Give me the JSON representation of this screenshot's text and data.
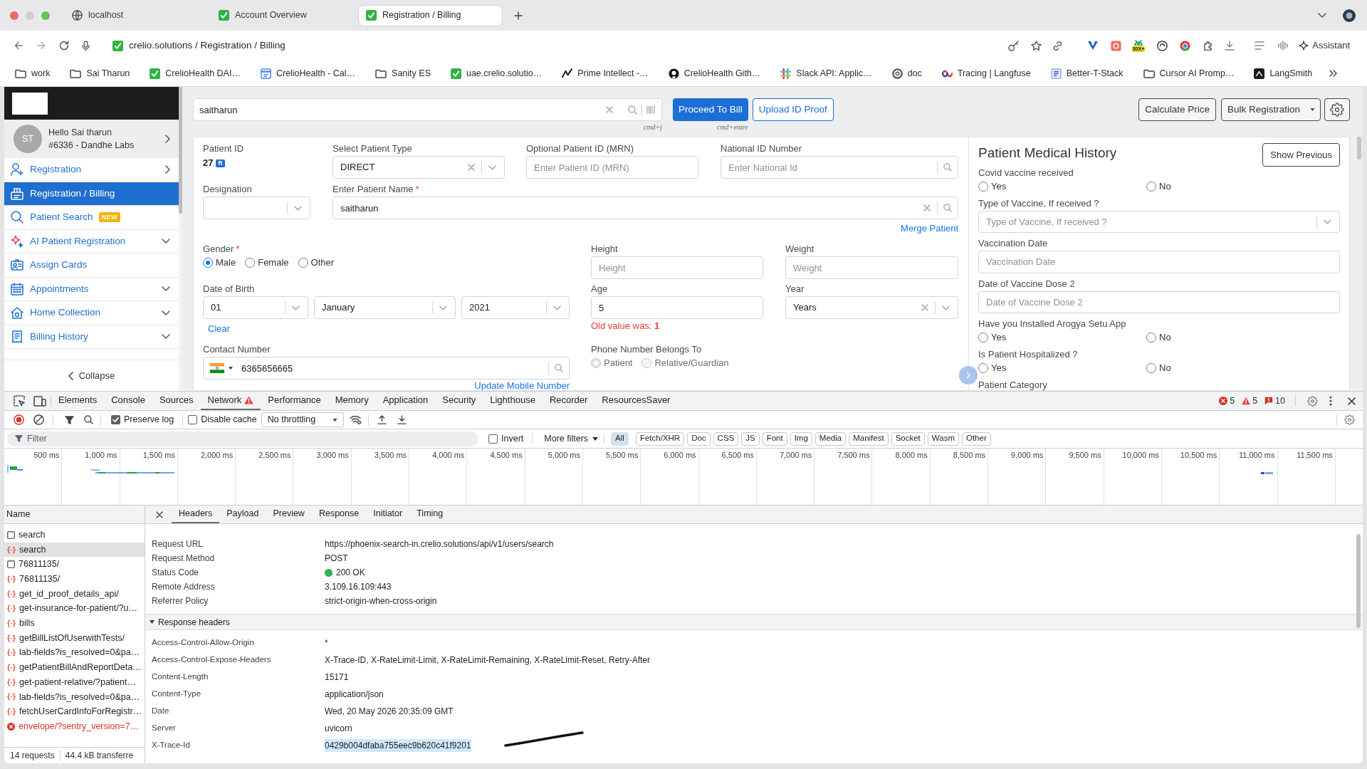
{
  "browser": {
    "tabs": [
      {
        "title": "localhost",
        "selected": false
      },
      {
        "title": "Account Overview",
        "selected": false
      },
      {
        "title": "Registration / Billing",
        "selected": true
      }
    ],
    "address": "crelio.solutions / Registration / Billing",
    "extension_badge": "30X+",
    "assistant": "Assistant",
    "bookmarks": [
      {
        "label": "work",
        "kind": "folder"
      },
      {
        "label": "Sai Tharun",
        "kind": "folder"
      },
      {
        "label": "CrelioHealth DAI…",
        "kind": "site"
      },
      {
        "label": "CrelioHealth - Cal…",
        "kind": "site"
      },
      {
        "label": "Sanity ES",
        "kind": "folder"
      },
      {
        "label": "uae.crelio.solutio…",
        "kind": "site"
      },
      {
        "label": "Prime Intellect -…",
        "kind": "site"
      },
      {
        "label": "CrelioHealth Gith…",
        "kind": "site"
      },
      {
        "label": "Slack API: Applic…",
        "kind": "site"
      },
      {
        "label": "doc",
        "kind": "site"
      },
      {
        "label": "Tracing | Langfuse",
        "kind": "site"
      },
      {
        "label": "Better-T-Stack",
        "kind": "site"
      },
      {
        "label": "Cursor AI Promp…",
        "kind": "folder"
      },
      {
        "label": "LangSmith",
        "kind": "site"
      }
    ]
  },
  "sidebar": {
    "avatar": "ST",
    "greeting": "Hello Sai tharun",
    "account": "#6336 - Dandhe Labs",
    "items": [
      {
        "label": "Registration",
        "kind": "flyout",
        "selected": false
      },
      {
        "label": "Registration / Billing",
        "kind": "page",
        "selected": true
      },
      {
        "label": "Patient Search",
        "kind": "page",
        "selected": false,
        "badge": "NEW"
      },
      {
        "label": "AI Patient Registration",
        "kind": "group",
        "selected": false
      },
      {
        "label": "Assign Cards",
        "kind": "page",
        "selected": false
      },
      {
        "label": "Appointments",
        "kind": "group",
        "selected": false
      },
      {
        "label": "Home Collection",
        "kind": "group",
        "selected": false
      },
      {
        "label": "Billing History",
        "kind": "group",
        "selected": false
      }
    ],
    "collapse": "Collapse"
  },
  "search": {
    "value": "saitharun",
    "shortcut": "cmd+j"
  },
  "actions": [
    {
      "label": "Proceed To Bill",
      "kind": "primary",
      "shortcut": "cmd+enter"
    },
    {
      "label": "Upload ID Proof",
      "kind": "outline"
    }
  ],
  "tools": [
    {
      "label": "Calculate Price",
      "kind": "button"
    },
    {
      "label": "Bulk Registration",
      "kind": "dropdown"
    }
  ],
  "form": {
    "patient_id": {
      "label": "Patient ID",
      "value": "27",
      "badge": "R"
    },
    "patient_type": {
      "label": "Select Patient Type",
      "value": "DIRECT"
    },
    "mrn": {
      "label": "Optional Patient ID (MRN)",
      "placeholder": "Enter Patient ID (MRN)"
    },
    "national_id": {
      "label": "National ID Number",
      "placeholder": "Enter National Id"
    },
    "designation": {
      "label": "Designation"
    },
    "patient_name": {
      "label": "Enter Patient Name",
      "required_mark": "*",
      "value": "saitharun"
    },
    "merge_link": "Merge Patient",
    "gender": {
      "label": "Gender",
      "required_mark": "*",
      "options": [
        {
          "label": "Male",
          "selected": true
        },
        {
          "label": "Female",
          "selected": false
        },
        {
          "label": "Other",
          "selected": false
        }
      ]
    },
    "height": {
      "label": "Height",
      "placeholder": "Height"
    },
    "weight": {
      "label": "Weight",
      "placeholder": "Weight"
    },
    "dob": {
      "label": "Date of Birth",
      "parts": [
        "01",
        "January",
        "2021"
      ],
      "clear_link": "Clear"
    },
    "age": {
      "label": "Age",
      "value": "5",
      "note": "Old value was: **1**"
    },
    "age_unit": {
      "label": "Year",
      "value": "Years"
    },
    "contact": {
      "label": "Contact Number",
      "value": "6365656665",
      "update_link": "Update Mobile Number"
    },
    "phone_owner": {
      "label": "Phone Number Belongs To",
      "disabled": true,
      "options": [
        {
          "label": "Patient",
          "selected": true
        },
        {
          "label": "Relative/Guardian",
          "selected": false
        }
      ]
    }
  },
  "history": {
    "title": "Patient Medical History",
    "show_previous": "Show Previous",
    "fields": [
      {
        "kind": "radio",
        "label": "Covid vaccine received",
        "options": [
          {
            "label": "Yes",
            "selected": false
          },
          {
            "label": "No",
            "selected": false
          }
        ]
      },
      {
        "kind": "select",
        "label": "Type of Vaccine, If received ?",
        "placeholder": "Type of Vaccine, If received ?"
      },
      {
        "kind": "input",
        "label": "Vaccination Date",
        "placeholder": "Vaccination Date"
      },
      {
        "kind": "input",
        "label": "Date of Vaccine Dose 2",
        "placeholder": "Date of Vaccine Dose 2"
      },
      {
        "kind": "radio",
        "label": "Have you Installed Arogya Setu App",
        "options": [
          {
            "label": "Yes",
            "selected": false
          },
          {
            "label": "No",
            "selected": false
          }
        ]
      },
      {
        "kind": "radio",
        "label": "Is Patient Hospitalized ?",
        "options": [
          {
            "label": "Yes",
            "selected": false
          },
          {
            "label": "No",
            "selected": false
          }
        ]
      },
      {
        "kind": "label",
        "label": "Patient Category"
      }
    ]
  },
  "devtools": {
    "tabs": [
      {
        "label": "Elements",
        "selected": false,
        "warning": false
      },
      {
        "label": "Console",
        "selected": false,
        "warning": false
      },
      {
        "label": "Sources",
        "selected": false,
        "warning": false
      },
      {
        "label": "Network",
        "selected": true,
        "warning": true
      },
      {
        "label": "Performance",
        "selected": false,
        "warning": false
      },
      {
        "label": "Memory",
        "selected": false,
        "warning": false
      },
      {
        "label": "Application",
        "selected": false,
        "warning": false
      },
      {
        "label": "Security",
        "selected": false,
        "warning": false
      },
      {
        "label": "Lighthouse",
        "selected": false,
        "warning": false
      },
      {
        "label": "Recorder",
        "selected": false,
        "warning": false
      },
      {
        "label": "ResourcesSaver",
        "selected": false,
        "warning": false
      }
    ],
    "counts": [
      {
        "kind": "error",
        "value": "5"
      },
      {
        "kind": "warning",
        "value": "5"
      },
      {
        "kind": "message",
        "value": "10"
      }
    ],
    "preserve_log": {
      "label": "Preserve log",
      "checked": true
    },
    "disable_cache": {
      "label": "Disable cache",
      "checked": false
    },
    "throttling": "No throttling",
    "filter": {
      "placeholder": "Filter",
      "invert": {
        "label": "Invert",
        "checked": false
      },
      "more_filters": "More filters",
      "types": [
        {
          "label": "All",
          "selected": true
        },
        {
          "label": "Fetch/XHR",
          "selected": false
        },
        {
          "label": "Doc",
          "selected": false
        },
        {
          "label": "CSS",
          "selected": false
        },
        {
          "label": "JS",
          "selected": false
        },
        {
          "label": "Font",
          "selected": false
        },
        {
          "label": "Img",
          "selected": false
        },
        {
          "label": "Media",
          "selected": false
        },
        {
          "label": "Manifest",
          "selected": false
        },
        {
          "label": "Socket",
          "selected": false
        },
        {
          "label": "Wasm",
          "selected": false
        },
        {
          "label": "Other",
          "selected": false
        }
      ]
    },
    "timeline_ticks": [
      "500 ms",
      "1,000 ms",
      "1,500 ms",
      "2,000 ms",
      "2,500 ms",
      "3,000 ms",
      "3,500 ms",
      "4,000 ms",
      "4,500 ms",
      "5,000 ms",
      "5,500 ms",
      "6,000 ms",
      "6,500 ms",
      "7,000 ms",
      "7,500 ms",
      "8,000 ms",
      "8,500 ms",
      "9,000 ms",
      "9,500 ms",
      "10,000 ms",
      "10,500 ms",
      "11,000 ms",
      "11,500 ms"
    ],
    "name_header": "Name",
    "requests": [
      {
        "name": "search",
        "kind": "document",
        "selected": false
      },
      {
        "name": "search",
        "kind": "fetch",
        "selected": true
      },
      {
        "name": "76811135/",
        "kind": "document",
        "selected": false
      },
      {
        "name": "76811135/",
        "kind": "fetch",
        "selected": false
      },
      {
        "name": "get_id_proof_details_api/",
        "kind": "fetch",
        "selected": false
      },
      {
        "name": "get-insurance-for-patient/?u…",
        "kind": "fetch",
        "selected": false
      },
      {
        "name": "bills",
        "kind": "fetch",
        "selected": false
      },
      {
        "name": "getBillListOfUserwithTests/",
        "kind": "fetch",
        "selected": false
      },
      {
        "name": "lab-fields?is_resolved=0&pa…",
        "kind": "fetch",
        "selected": false
      },
      {
        "name": "getPatientBillAndReportDeta…",
        "kind": "fetch",
        "selected": false
      },
      {
        "name": "get-patient-relative/?patient…",
        "kind": "fetch",
        "selected": false
      },
      {
        "name": "lab-fields?is_resolved=0&pa…",
        "kind": "fetch",
        "selected": false
      },
      {
        "name": "fetchUserCardInfoForRegistr…",
        "kind": "fetch",
        "selected": false
      },
      {
        "name": "envelope/?sentry_version=7…",
        "kind": "failed",
        "selected": false
      }
    ],
    "summary": {
      "requests": "14 requests",
      "transferred": "44.4 kB transferre"
    },
    "detail_tabs": [
      {
        "label": "Headers",
        "selected": true
      },
      {
        "label": "Payload",
        "selected": false
      },
      {
        "label": "Preview",
        "selected": false
      },
      {
        "label": "Response",
        "selected": false
      },
      {
        "label": "Initiator",
        "selected": false
      },
      {
        "label": "Timing",
        "selected": false
      }
    ],
    "general": [
      {
        "name": "Request URL",
        "value": "https://phoenix-search-in.crelio.solutions/api/v1/users/search"
      },
      {
        "name": "Request Method",
        "value": "POST"
      },
      {
        "name": "Status Code",
        "value": "200 OK",
        "color": "#2fb350"
      },
      {
        "name": "Remote Address",
        "value": "3.109.16.109:443"
      },
      {
        "name": "Referrer Policy",
        "value": "strict-origin-when-cross-origin"
      }
    ],
    "response_section": {
      "title": "Response headers",
      "expanded": true
    },
    "response_headers": [
      {
        "name": "Access-Control-Allow-Origin",
        "value": "*",
        "highlighted": false
      },
      {
        "name": "Access-Control-Expose-Headers",
        "value": "X-Trace-ID, X-RateLimit-Limit, X-RateLimit-Remaining, X-RateLimit-Reset, Retry-After",
        "highlighted": false
      },
      {
        "name": "Content-Length",
        "value": "15171",
        "highlighted": false
      },
      {
        "name": "Content-Type",
        "value": "application/json",
        "highlighted": false
      },
      {
        "name": "Date",
        "value": "Wed, 20 May 2026 20:35:09 GMT",
        "highlighted": false
      },
      {
        "name": "Server",
        "value": "uvicorn",
        "highlighted": false
      },
      {
        "name": "X-Trace-Id",
        "value": "0429b004dfaba755eec9b620c41f9201",
        "highlighted": true
      }
    ]
  }
}
